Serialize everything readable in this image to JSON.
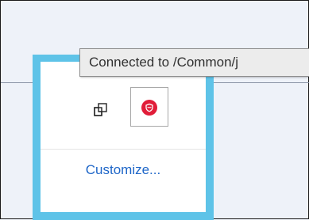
{
  "tooltip": {
    "text": "Connected to /Common/j"
  },
  "popup": {
    "customize_label": "Customize..."
  },
  "icons": {
    "left": "copy-icon",
    "right": "shield-icon"
  },
  "colors": {
    "popup_border": "#5ec3e8",
    "shield_red": "#e11d39",
    "link_blue": "#1e66c8",
    "background": "#eef2f9"
  }
}
